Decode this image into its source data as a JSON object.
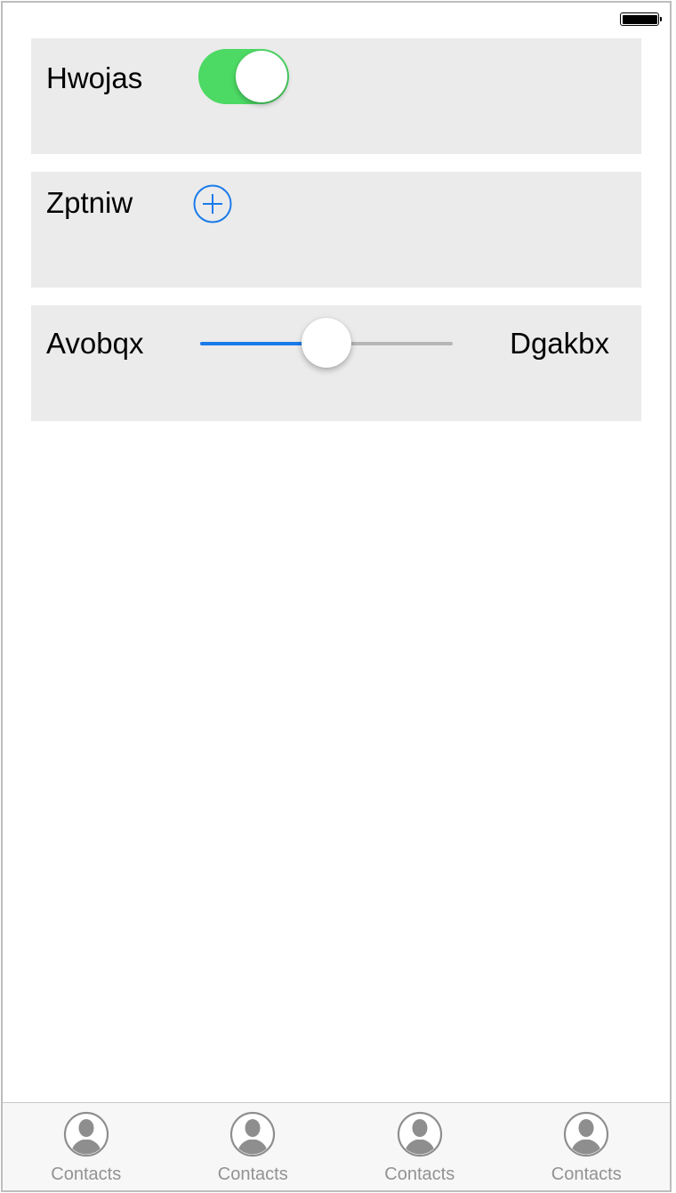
{
  "status_bar": {
    "battery_icon": "battery-full-icon"
  },
  "rows": [
    {
      "label": "Hwojas",
      "control": "switch",
      "switch_on": true,
      "switch_color": "#4cd964"
    },
    {
      "label": "Zptniw",
      "control": "add-button",
      "icon": "plus-circle-icon",
      "accent": "#1a7bea"
    },
    {
      "label": "Avobqx",
      "control": "slider",
      "slider_value": 0.5,
      "right_label": "Dgakbx",
      "accent": "#1a7bea"
    }
  ],
  "tab_bar": {
    "items": [
      {
        "label": "Contacts",
        "icon": "contact-person-icon"
      },
      {
        "label": "Contacts",
        "icon": "contact-person-icon"
      },
      {
        "label": "Contacts",
        "icon": "contact-person-icon"
      },
      {
        "label": "Contacts",
        "icon": "contact-person-icon"
      }
    ]
  }
}
